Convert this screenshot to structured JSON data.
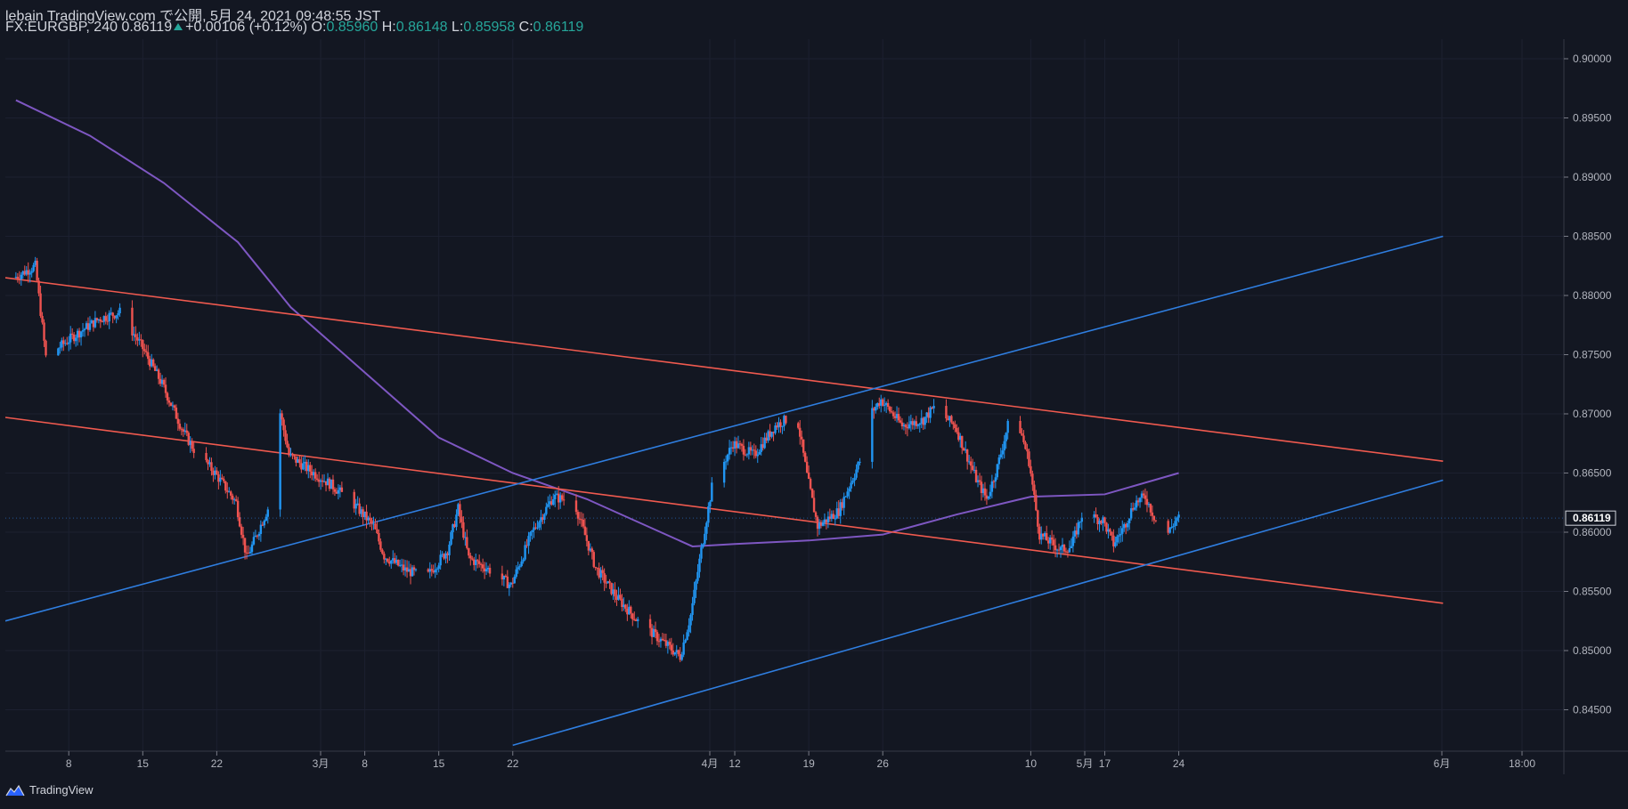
{
  "header": {
    "line1": "lebain TradingView.com で公開, 5月 24, 2021 09:48:55 JST",
    "symbol": "FX:EURGBP, 240",
    "last": "0.86119",
    "change": "+0.00106 (+0.12%)",
    "o_label": "O:",
    "o_value": "0.85960",
    "h_label": "H:",
    "h_value": "0.86148",
    "l_label": "L:",
    "l_value": "0.85958",
    "c_label": "C:",
    "c_value": "0.86119"
  },
  "footer": {
    "brand": "TradingView",
    "logo_icon": "tradingview-logo-icon"
  },
  "colors": {
    "background": "#131722",
    "up": "#2196f3",
    "down": "#ef5350",
    "ma": "#7e57c2",
    "trend_red": "#f05a4f",
    "trend_blue": "#2f7ee0",
    "text": "#d1d4dc"
  },
  "chart_data": {
    "type": "candlestick",
    "symbol": "FX:EURGBP",
    "interval": "240",
    "ylim": [
      0.8418,
      0.9027
    ],
    "y_ticks": [
      "0.90000",
      "0.89500",
      "0.89000",
      "0.88500",
      "0.88000",
      "0.87500",
      "0.87000",
      "0.86500",
      "0.86000",
      "0.85500",
      "0.85000",
      "0.84500"
    ],
    "x_ticks": [
      "8",
      "15",
      "22",
      "3月",
      "8",
      "15",
      "22",
      "4月",
      "12",
      "19",
      "26",
      "5月",
      "10",
      "17",
      "24",
      "6月",
      "18:00"
    ],
    "last_price_label": "0.86119",
    "price_path": [
      {
        "d": "2021-02-03",
        "p": 0.8815
      },
      {
        "d": "2021-02-05",
        "p": 0.8825
      },
      {
        "d": "2021-02-06",
        "p": 0.8748
      },
      {
        "d": "2021-02-09",
        "p": 0.8768
      },
      {
        "d": "2021-02-11",
        "p": 0.878
      },
      {
        "d": "2021-02-13",
        "p": 0.8786
      },
      {
        "d": "2021-02-15",
        "p": 0.8758
      },
      {
        "d": "2021-02-17",
        "p": 0.8725
      },
      {
        "d": "2021-02-19",
        "p": 0.8685
      },
      {
        "d": "2021-02-20",
        "p": 0.867
      },
      {
        "d": "2021-02-22",
        "p": 0.865
      },
      {
        "d": "2021-02-24",
        "p": 0.8625
      },
      {
        "d": "2021-02-25",
        "p": 0.8578
      },
      {
        "d": "2021-02-27",
        "p": 0.862
      },
      {
        "d": "2021-02-28",
        "p": 0.8708
      },
      {
        "d": "2021-03-01",
        "p": 0.8665
      },
      {
        "d": "2021-03-03",
        "p": 0.8652
      },
      {
        "d": "2021-03-05",
        "p": 0.864
      },
      {
        "d": "2021-03-07",
        "p": 0.8625
      },
      {
        "d": "2021-03-09",
        "p": 0.8605
      },
      {
        "d": "2021-03-10",
        "p": 0.858
      },
      {
        "d": "2021-03-12",
        "p": 0.8568
      },
      {
        "d": "2021-03-14",
        "p": 0.8562
      },
      {
        "d": "2021-03-16",
        "p": 0.8585
      },
      {
        "d": "2021-03-17",
        "p": 0.862
      },
      {
        "d": "2021-03-18",
        "p": 0.8578
      },
      {
        "d": "2021-03-20",
        "p": 0.8568
      },
      {
        "d": "2021-03-22",
        "p": 0.8555
      },
      {
        "d": "2021-03-24",
        "p": 0.86
      },
      {
        "d": "2021-03-26",
        "p": 0.863
      },
      {
        "d": "2021-03-28",
        "p": 0.8625
      },
      {
        "d": "2021-03-30",
        "p": 0.857
      },
      {
        "d": "2021-04-01",
        "p": 0.8545
      },
      {
        "d": "2021-04-03",
        "p": 0.8525
      },
      {
        "d": "2021-04-05",
        "p": 0.851
      },
      {
        "d": "2021-04-07",
        "p": 0.8495
      },
      {
        "d": "2021-04-08",
        "p": 0.853
      },
      {
        "d": "2021-04-09",
        "p": 0.8585
      },
      {
        "d": "2021-04-10",
        "p": 0.8638
      },
      {
        "d": "2021-04-12",
        "p": 0.8675
      },
      {
        "d": "2021-04-14",
        "p": 0.8665
      },
      {
        "d": "2021-04-16",
        "p": 0.869
      },
      {
        "d": "2021-04-18",
        "p": 0.87
      },
      {
        "d": "2021-04-19",
        "p": 0.8648
      },
      {
        "d": "2021-04-20",
        "p": 0.8605
      },
      {
        "d": "2021-04-22",
        "p": 0.8618
      },
      {
        "d": "2021-04-24",
        "p": 0.866
      },
      {
        "d": "2021-04-25",
        "p": 0.87
      },
      {
        "d": "2021-04-26",
        "p": 0.8712
      },
      {
        "d": "2021-04-28",
        "p": 0.869
      },
      {
        "d": "2021-04-30",
        "p": 0.8695
      },
      {
        "d": "2021-05-01",
        "p": 0.8705
      },
      {
        "d": "2021-05-03",
        "p": 0.869
      },
      {
        "d": "2021-05-05",
        "p": 0.8645
      },
      {
        "d": "2021-05-06",
        "p": 0.8628
      },
      {
        "d": "2021-05-07",
        "p": 0.8655
      },
      {
        "d": "2021-05-08",
        "p": 0.869
      },
      {
        "d": "2021-05-09",
        "p": 0.8692
      },
      {
        "d": "2021-05-10",
        "p": 0.866
      },
      {
        "d": "2021-05-11",
        "p": 0.8598
      },
      {
        "d": "2021-05-13",
        "p": 0.8585
      },
      {
        "d": "2021-05-14",
        "p": 0.8588
      },
      {
        "d": "2021-05-15",
        "p": 0.8615
      },
      {
        "d": "2021-05-17",
        "p": 0.861
      },
      {
        "d": "2021-05-18",
        "p": 0.859
      },
      {
        "d": "2021-05-19",
        "p": 0.8605
      },
      {
        "d": "2021-05-20",
        "p": 0.8625
      },
      {
        "d": "2021-05-21",
        "p": 0.863
      },
      {
        "d": "2021-05-22",
        "p": 0.861
      },
      {
        "d": "2021-05-23",
        "p": 0.8597
      },
      {
        "d": "2021-05-24",
        "p": 0.8612
      }
    ],
    "moving_average": [
      {
        "d": "2021-02-03",
        "p": 0.8965
      },
      {
        "d": "2021-02-10",
        "p": 0.8935
      },
      {
        "d": "2021-02-17",
        "p": 0.8895
      },
      {
        "d": "2021-02-24",
        "p": 0.8845
      },
      {
        "d": "2021-03-01",
        "p": 0.879
      },
      {
        "d": "2021-03-08",
        "p": 0.8735
      },
      {
        "d": "2021-03-15",
        "p": 0.868
      },
      {
        "d": "2021-03-22",
        "p": 0.865
      },
      {
        "d": "2021-03-29",
        "p": 0.8628
      },
      {
        "d": "2021-04-05",
        "p": 0.86
      },
      {
        "d": "2021-04-08",
        "p": 0.8588
      },
      {
        "d": "2021-04-12",
        "p": 0.859
      },
      {
        "d": "2021-04-19",
        "p": 0.8593
      },
      {
        "d": "2021-04-26",
        "p": 0.8598
      },
      {
        "d": "2021-05-03",
        "p": 0.8615
      },
      {
        "d": "2021-05-10",
        "p": 0.863
      },
      {
        "d": "2021-05-17",
        "p": 0.8632
      },
      {
        "d": "2021-05-24",
        "p": 0.865
      }
    ],
    "trendlines": [
      {
        "color": "red",
        "from": {
          "d": "2021-02-02",
          "p": 0.8815
        },
        "to": {
          "d": "2021-06-18",
          "p": 0.866
        }
      },
      {
        "color": "red",
        "from": {
          "d": "2021-02-02",
          "p": 0.8697
        },
        "to": {
          "d": "2021-06-18",
          "p": 0.854
        }
      },
      {
        "color": "blue",
        "from": {
          "d": "2021-02-02",
          "p": 0.8525
        },
        "to": {
          "d": "2021-06-18",
          "p": 0.885
        }
      },
      {
        "color": "blue",
        "from": {
          "d": "2021-03-22",
          "p": 0.842
        },
        "to": {
          "d": "2021-06-18",
          "p": 0.8644
        }
      }
    ]
  }
}
